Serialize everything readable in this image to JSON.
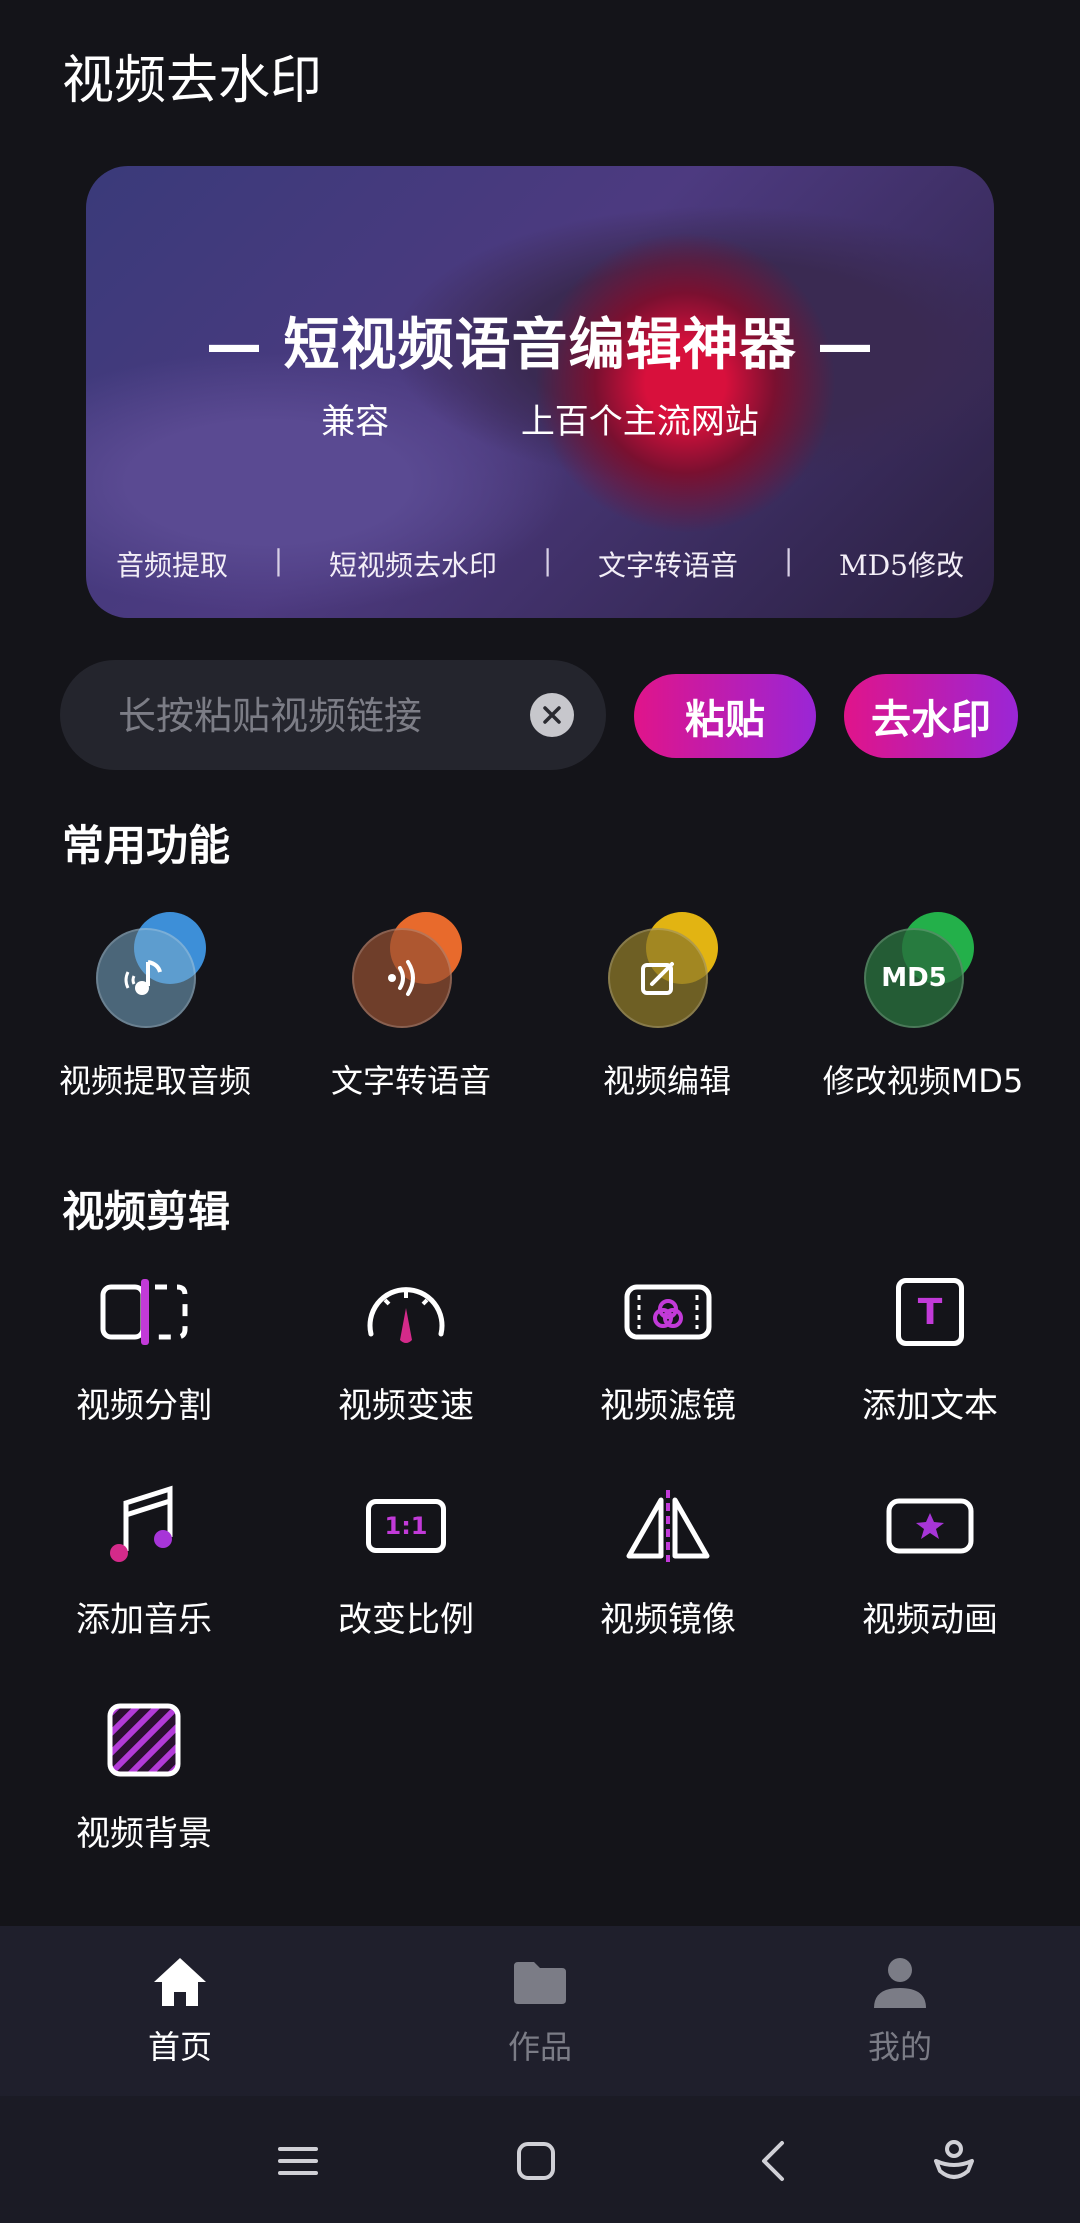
{
  "app": {
    "title": "视频去水印"
  },
  "banner": {
    "title": "— 短视频语音编辑神器 —",
    "subtitle_left": "兼容",
    "subtitle_right": "上百个主流网站",
    "tags": [
      "音频提取",
      "短视频去水印",
      "文字转语音",
      "MD5修改"
    ],
    "separator": "|"
  },
  "search": {
    "placeholder": "长按粘贴视频链接",
    "value": ""
  },
  "actions": {
    "paste_label": "粘贴",
    "remove_watermark_label": "去水印"
  },
  "common": {
    "title": "常用功能",
    "items": [
      {
        "label": "视频提取音频",
        "icon": "music-note-icon",
        "color": "#3d8fd8"
      },
      {
        "label": "文字转语音",
        "icon": "speaker-waves-icon",
        "color": "#e86a2c"
      },
      {
        "label": "视频编辑",
        "icon": "edit-icon",
        "color": "#e2b412"
      },
      {
        "label": "修改视频MD5",
        "icon": "md5-icon",
        "color": "#23b04a",
        "icon_text": "MD5"
      }
    ]
  },
  "editing": {
    "title": "视频剪辑",
    "items": [
      {
        "label": "视频分割",
        "icon": "split-icon"
      },
      {
        "label": "视频变速",
        "icon": "speedometer-icon"
      },
      {
        "label": "视频滤镜",
        "icon": "filter-icon"
      },
      {
        "label": "添加文本",
        "icon": "text-icon",
        "icon_text": "T"
      },
      {
        "label": "添加音乐",
        "icon": "music-icon"
      },
      {
        "label": "改变比例",
        "icon": "ratio-icon",
        "icon_text": "1:1"
      },
      {
        "label": "视频镜像",
        "icon": "mirror-icon"
      },
      {
        "label": "视频动画",
        "icon": "star-animation-icon"
      },
      {
        "label": "视频背景",
        "icon": "background-icon"
      }
    ]
  },
  "tabs": [
    {
      "label": "首页",
      "icon": "home-icon",
      "active": true
    },
    {
      "label": "作品",
      "icon": "folder-icon",
      "active": false
    },
    {
      "label": "我的",
      "icon": "user-icon",
      "active": false
    }
  ],
  "colors": {
    "accent_start": "#e0148a",
    "accent_end": "#9a26d6",
    "background": "#141419"
  }
}
